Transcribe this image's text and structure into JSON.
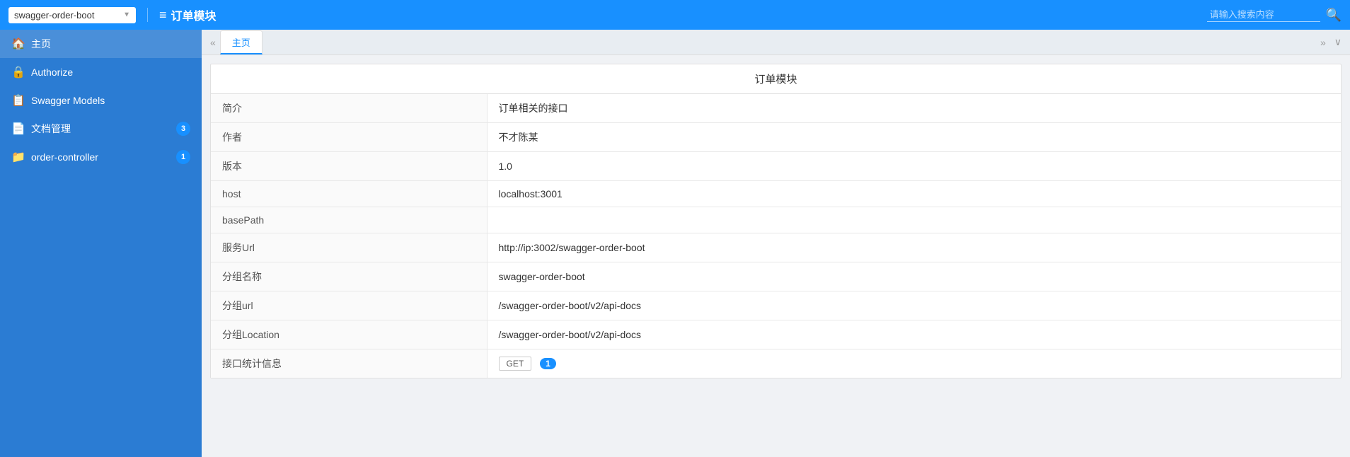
{
  "header": {
    "select_value": "swagger-order-boot",
    "select_options": [
      "swagger-order-boot"
    ],
    "title_icon": "≡",
    "title": "订单模块",
    "search_placeholder": "请输入搜索内容"
  },
  "sidebar": {
    "items": [
      {
        "id": "home",
        "label": "主页",
        "icon": "🏠",
        "badge": null,
        "active": true
      },
      {
        "id": "authorize",
        "label": "Authorize",
        "icon": "🔒",
        "badge": null,
        "active": false
      },
      {
        "id": "swagger-models",
        "label": "Swagger Models",
        "icon": "📋",
        "badge": null,
        "active": false
      },
      {
        "id": "doc-management",
        "label": "文档管理",
        "icon": "📄",
        "badge": "3",
        "active": false
      },
      {
        "id": "order-controller",
        "label": "order-controller",
        "icon": "📁",
        "badge": "1",
        "active": false
      }
    ]
  },
  "tabs": {
    "items": [
      {
        "label": "主页",
        "active": true
      }
    ]
  },
  "info_panel": {
    "title": "订单模块",
    "rows": [
      {
        "label": "简介",
        "value": "订单相关的接口",
        "type": "text"
      },
      {
        "label": "作者",
        "value": "不才陈某",
        "type": "text"
      },
      {
        "label": "版本",
        "value": "1.0",
        "type": "text"
      },
      {
        "label": "host",
        "value": "localhost:3001",
        "type": "text"
      },
      {
        "label": "basePath",
        "value": "",
        "type": "text"
      },
      {
        "label": "服务Url",
        "value": "http://ip:3002/swagger-order-boot",
        "type": "text"
      },
      {
        "label": "分组名称",
        "value": "swagger-order-boot",
        "type": "text"
      },
      {
        "label": "分组url",
        "value": "/swagger-order-boot/v2/api-docs",
        "type": "text"
      },
      {
        "label": "分组Location",
        "value": "/swagger-order-boot/v2/api-docs",
        "type": "text"
      },
      {
        "label": "接口统计信息",
        "value": "",
        "type": "stats",
        "get_label": "GET",
        "count": "1"
      }
    ]
  },
  "icons": {
    "chevron_left": "«",
    "chevron_right": "»",
    "chevron_down": "∨",
    "expand": "⤢"
  }
}
